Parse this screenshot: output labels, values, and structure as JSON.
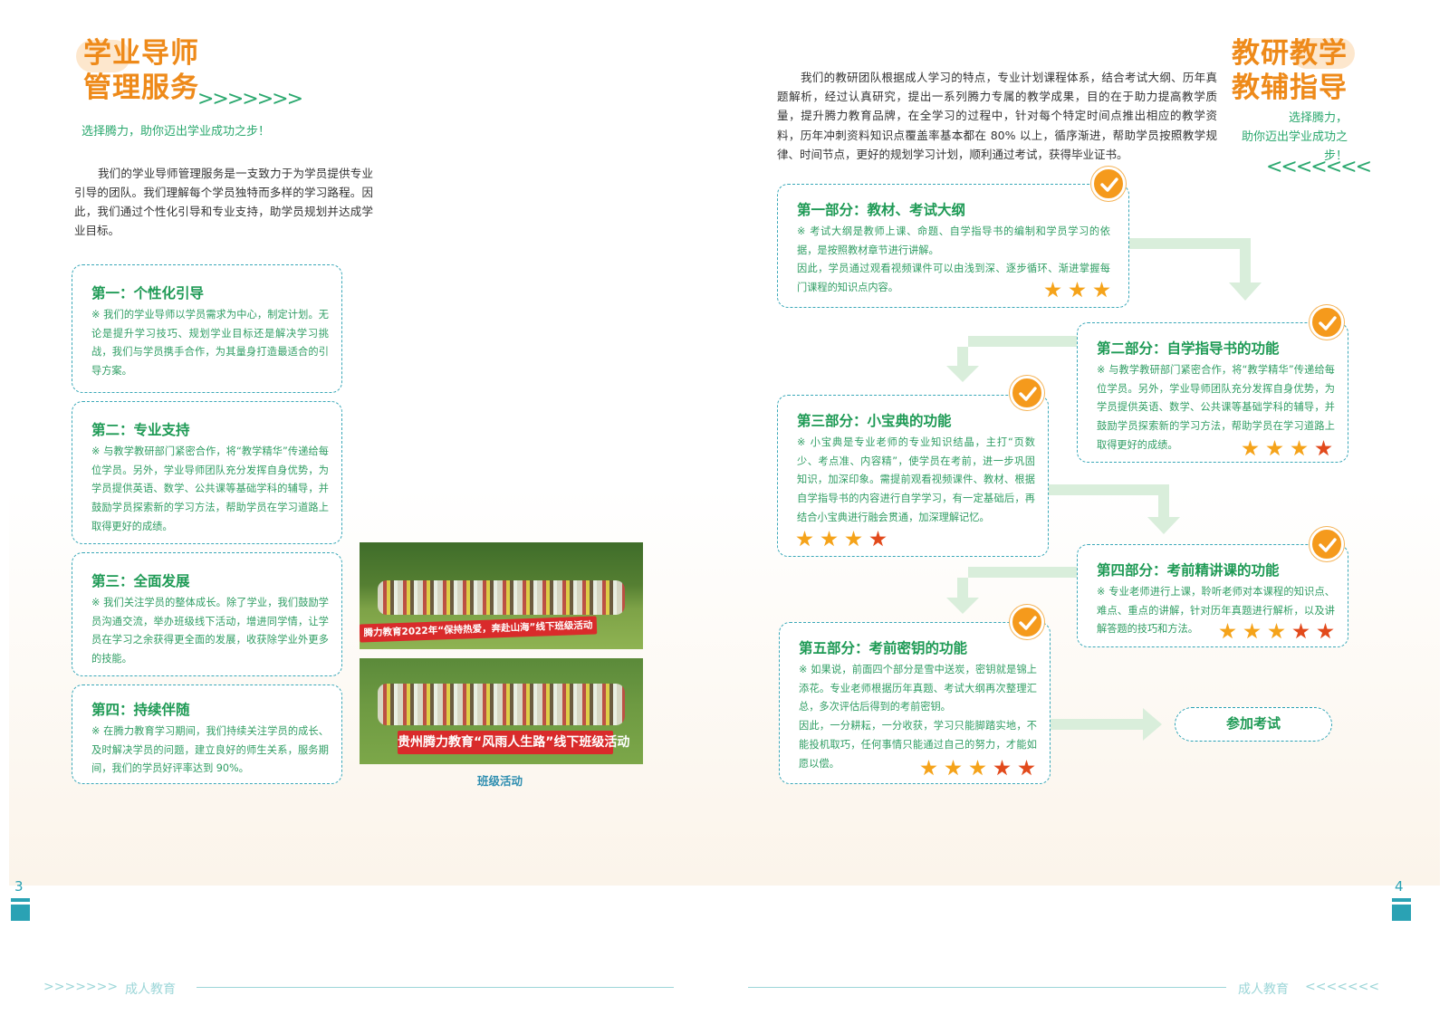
{
  "left_page": {
    "title_line1": "学业导师",
    "title_line2": "管理服务",
    "chevrons": ">>>>>>>",
    "subtitle": "选择腾力，助你迈出学业成功之步！",
    "intro": "我们的学业导师管理服务是一支致力于为学员提供专业引导的团队。我们理解每个学员独特而多样的学习路程。因此，我们通过个性化引导和专业支持，助学员规划并达成学业目标。",
    "cards": [
      {
        "title": "第一：个性化引导",
        "text": "※ 我们的学业导师以学员需求为中心，制定计划。无论是提升学习技巧、规划学业目标还是解决学习挑战，我们与学员携手合作，为其量身打造最适合的引导方案。"
      },
      {
        "title": "第二：专业支持",
        "text": "※ 与教学教研部门紧密合作，将“教学精华”传递给每位学员。另外，学业导师团队充分发挥自身优势，为学员提供英语、数学、公共课等基础学科的辅导，并鼓励学员探索新的学习方法，帮助学员在学习道路上取得更好的成绩。"
      },
      {
        "title": "第三：全面发展",
        "text": "※ 我们关注学员的整体成长。除了学业，我们鼓励学员沟通交流，举办班级线下活动，增进同学情，让学员在学习之余获得更全面的发展，收获除学业外更多的技能。"
      },
      {
        "title": "第四：持续伴随",
        "text": "※ 在腾力教育学习期间，我们持续关注学员的成长、及时解决学员的问题，建立良好的师生关系，服务期间，我们的学员好评率达到 90%。"
      }
    ],
    "photo1_banner": "腾力教育2022年“保持热爱，奔赴山海”线下班级活动",
    "photo2_banner": "贵州腾力教育“风雨人生路”线下班级活动",
    "photo_caption": "班级活动",
    "page_number": "3",
    "footer_chevrons": ">>>>>>>",
    "footer_text": "成人教育"
  },
  "right_page": {
    "title_line1": "教研教学",
    "title_line2": "教辅指导",
    "subtitle_line1": "选择腾力，",
    "subtitle_line2": "助你迈出学业成功之步！",
    "chevrons": "<<<<<<<",
    "intro": "我们的教研团队根据成人学习的特点，专业计划课程体系，结合考试大纲、历年真题解析，经过认真研究，提出一系列腾力专属的教学成果，目的在于助力提高教学质量，提升腾力教育品牌，在全学习的过程中，针对每个特定时间点推出相应的教学资料，历年冲刺资料知识点覆盖率基本都在 80% 以上，循序渐进，帮助学员按照教学规律、时间节点，更好的规划学习计划，顺利通过考试，获得毕业证书。",
    "parts": [
      {
        "title": "第一部分：教材、考试大纲",
        "text1": "※ 考试大纲是教师上课、命题、自学指导书的编制和学员学习的依据，是按照教材章节进行讲解。",
        "text2": "因此，学员通过观看视频课件可以由浅到深、逐步循环、渐进掌握每门课程的知识点内容。",
        "stars": 3
      },
      {
        "title": "第二部分：自学指导书的功能",
        "text1": "※ 与教学教研部门紧密合作，将“教学精华”传递给每位学员。另外，学业导师团队充分发挥自身优势，为学员提供英语、数学、公共课等基础学科的辅导，并鼓励学员探索新的学习方法，帮助学员在学习道路上取得更好的成绩。",
        "text2": "",
        "stars": 4
      },
      {
        "title": "第三部分：小宝典的功能",
        "text1": "※ 小宝典是专业老师的专业知识结晶，主打“页数少、考点准、内容精”，使学员在考前，进一步巩固知识，加深印象。需提前观看视频课件、教材、根据自学指导书的内容进行自学学习，有一定基础后，再结合小宝典进行融会贯通，加深理解记忆。",
        "text2": "",
        "stars": 4
      },
      {
        "title": "第四部分：考前精讲课的功能",
        "text1": "※ 专业老师进行上课，聆听老师对本课程的知识点、难点、重点的讲解，针对历年真题进行解析，以及讲解答题的技巧和方法。",
        "text2": "",
        "stars": 5
      },
      {
        "title": "第五部分：考前密钥的功能",
        "text1": "※ 如果说，前面四个部分是雪中送炭，密钥就是锦上添花。专业老师根据历年真题、考试大纲再次整理汇总，多次评估后得到的考前密钥。",
        "text2": "因此，一分耕耘，一分收获，学习只能脚踏实地，不能投机取巧，任何事情只能通过自己的努力，才能如愿以偿。",
        "stars": 5
      }
    ],
    "final_step": "参加考试",
    "page_number": "4",
    "footer_text": "成人教育",
    "footer_chevrons": "<<<<<<<"
  },
  "colors": {
    "orange": "#ee8a1a",
    "green": "#1e9a55",
    "teal": "#2aa2b4",
    "star_orange": "#f5a31a",
    "star_red": "#e24a1c"
  }
}
